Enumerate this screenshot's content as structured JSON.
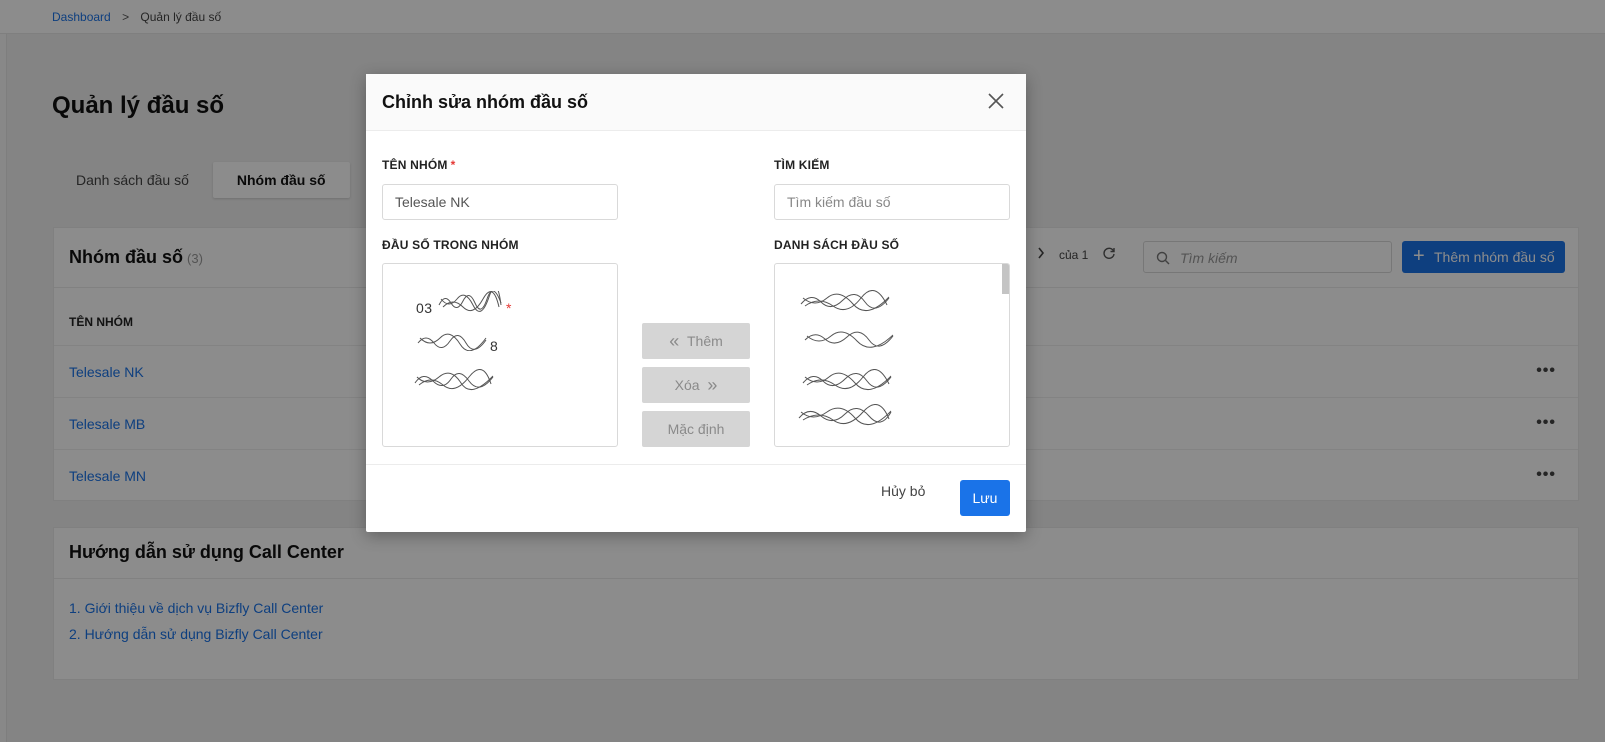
{
  "breadcrumb": {
    "home": "Dashboard",
    "separator": ">",
    "current": "Quản lý đầu số"
  },
  "page": {
    "title": "Quản lý đầu số"
  },
  "tabs": [
    {
      "label": "Danh sách đầu số",
      "active": false
    },
    {
      "label": "Nhóm đầu số",
      "active": true
    }
  ],
  "group_card": {
    "title": "Nhóm đầu số",
    "count": "(3)",
    "pager_of": "của 1",
    "search_placeholder": "Tìm kiếm",
    "add_button": "Thêm nhóm đầu số",
    "column_name": "TÊN NHÓM",
    "rows": [
      {
        "name": "Telesale NK"
      },
      {
        "name": "Telesale MB"
      },
      {
        "name": "Telesale MN"
      }
    ]
  },
  "guide": {
    "title": "Hướng dẫn sử dụng Call Center",
    "links": [
      "1. Giới thiệu về dịch vụ Bizfly Call Center",
      "2. Hướng dẫn sử dụng Bizfly Call Center"
    ]
  },
  "modal": {
    "title": "Chỉnh sửa nhóm đầu số",
    "group_name_label": "TÊN NHÓM",
    "group_name_required": "*",
    "group_name_value": "Telesale NK",
    "search_label": "TÌM KIẾM",
    "search_placeholder": "Tìm kiếm đầu số",
    "in_group_label": "ĐẦU SỐ TRONG NHÓM",
    "in_group": [
      {
        "prefix": "03",
        "suffix": "",
        "default": true
      },
      {
        "prefix": "",
        "suffix": "8",
        "default": false
      },
      {
        "prefix": "",
        "suffix": "",
        "default": false
      }
    ],
    "available_label": "DANH SÁCH ĐẦU SỐ",
    "available": [
      {
        "text": ""
      },
      {
        "text": ""
      },
      {
        "text": ""
      },
      {
        "text": ""
      }
    ],
    "add_button": "Thêm",
    "remove_button": "Xóa",
    "default_button": "Mặc định",
    "cancel_button": "Hủy bỏ",
    "save_button": "Lưu"
  },
  "colors": {
    "accent": "#1a73e8",
    "required": "#e53935",
    "disabled_bg": "#d5d5d5"
  },
  "icons": [
    "close-icon",
    "search-icon",
    "refresh-icon",
    "chevron-right-icon",
    "double-chevron-left-icon",
    "double-chevron-right-icon",
    "more-icon",
    "plus-icon"
  ]
}
